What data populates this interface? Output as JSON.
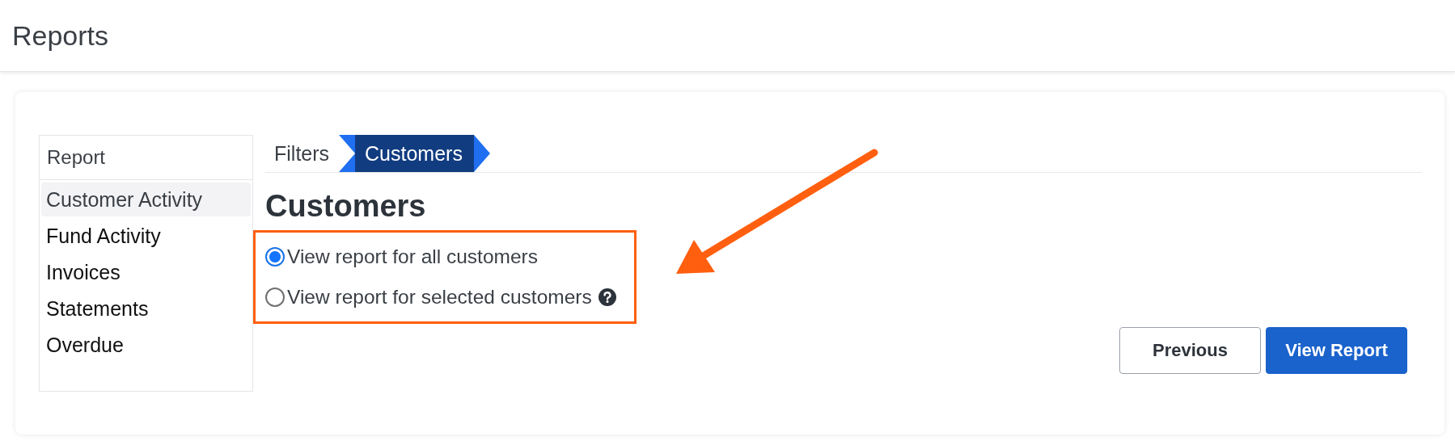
{
  "header": {
    "title": "Reports"
  },
  "sidebar": {
    "title": "Report",
    "items": [
      {
        "label": "Customer Activity",
        "selected": true
      },
      {
        "label": "Fund Activity",
        "selected": false
      },
      {
        "label": "Invoices",
        "selected": false
      },
      {
        "label": "Statements",
        "selected": false
      },
      {
        "label": "Overdue",
        "selected": false
      }
    ]
  },
  "steps": [
    {
      "label": "Filters",
      "selected": false
    },
    {
      "label": "Customers",
      "selected": true
    }
  ],
  "section": {
    "title": "Customers",
    "options": [
      {
        "label": "View report for all customers",
        "selected": true,
        "help": false
      },
      {
        "label": "View report for selected customers",
        "selected": false,
        "help": true
      }
    ]
  },
  "buttons": [
    {
      "label": "Previous",
      "kind": "secondary"
    },
    {
      "label": "View Report",
      "kind": "primary"
    }
  ]
}
